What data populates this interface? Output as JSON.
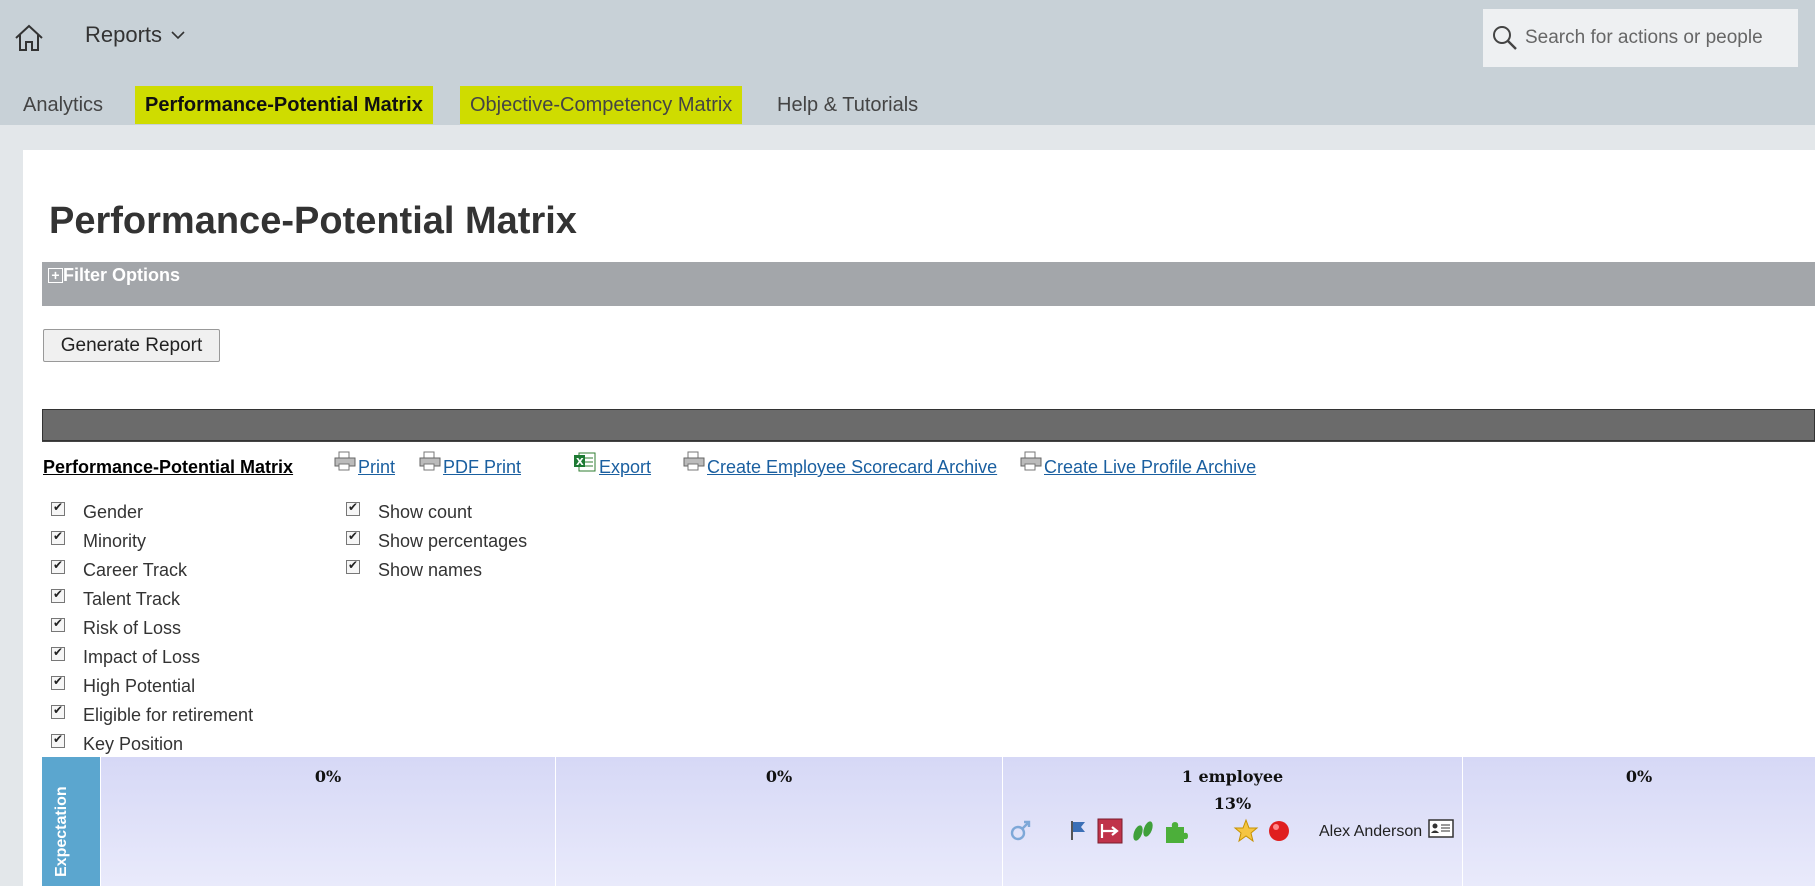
{
  "header": {
    "menu_label": "Reports",
    "search_placeholder": "Search for actions or people"
  },
  "tabs": [
    {
      "label": "Analytics",
      "highlighted": false,
      "active": false
    },
    {
      "label": "Performance-Potential Matrix",
      "highlighted": true,
      "active": true
    },
    {
      "label": "Objective-Competency Matrix",
      "highlighted": true,
      "active": false
    },
    {
      "label": "Help & Tutorials",
      "highlighted": false,
      "active": false
    }
  ],
  "page": {
    "title": "Performance-Potential Matrix",
    "filter_label": "Filter Options",
    "generate_button": "Generate Report"
  },
  "toolbar": {
    "matrix_label": "Performance-Potential Matrix",
    "links": [
      {
        "label": "Print",
        "icon": "printer-icon"
      },
      {
        "label": "PDF Print ",
        "icon": "printer-icon"
      },
      {
        "label": " Export ",
        "icon": "excel-icon"
      },
      {
        "label": "Create Employee Scorecard Archive",
        "icon": "printer-icon"
      },
      {
        "label": "Create Live Profile Archive",
        "icon": "printer-icon"
      }
    ]
  },
  "checkboxes_left": [
    {
      "label": "Gender",
      "checked": true
    },
    {
      "label": "Minority",
      "checked": true
    },
    {
      "label": "Career Track",
      "checked": true
    },
    {
      "label": "Talent Track",
      "checked": true
    },
    {
      "label": "Risk of Loss",
      "checked": true
    },
    {
      "label": "Impact of Loss",
      "checked": true
    },
    {
      "label": "High Potential",
      "checked": true
    },
    {
      "label": "Eligible for retirement",
      "checked": true
    },
    {
      "label": "Key Position",
      "checked": true
    }
  ],
  "checkboxes_right": [
    {
      "label": "Show count",
      "checked": true
    },
    {
      "label": "Show percentages",
      "checked": true
    },
    {
      "label": "Show names",
      "checked": true
    }
  ],
  "matrix": {
    "y_label": "Expectation",
    "cells": [
      {
        "count": "",
        "pct": "0%"
      },
      {
        "count": "",
        "pct": "0%"
      },
      {
        "count": "1 employee",
        "pct": "13%"
      },
      {
        "count": "",
        "pct": "0%"
      }
    ],
    "employee": {
      "name": "Alex Anderson",
      "icons": [
        "gender-male-icon",
        "career-flag-icon",
        "transfer-arrow-icon",
        "footsteps-icon",
        "puzzle-piece-icon",
        "star-badge-icon",
        "risk-red-dot-icon",
        "profile-card-icon"
      ]
    }
  },
  "colors": {
    "header_bg": "#c8d1d7",
    "tab_highlight": "#cfdc00",
    "filter_bar": "#a3a6aa",
    "link": "#1a5fa0",
    "matrix_cell": "#d6d8f6",
    "axis_label_bg": "#5ba6cf"
  }
}
